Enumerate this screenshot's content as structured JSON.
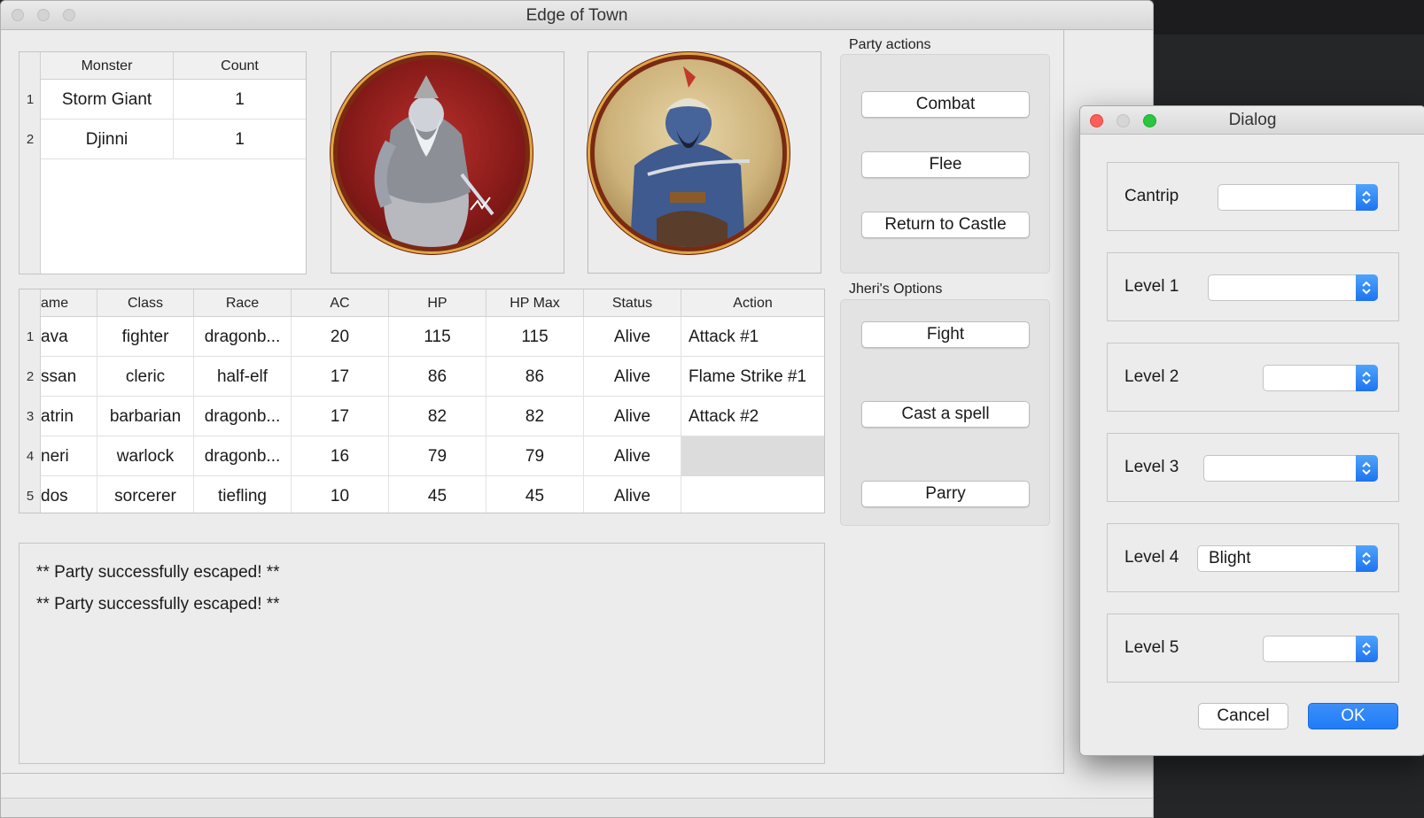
{
  "window": {
    "title": "Edge of Town"
  },
  "monster_table": {
    "headers": [
      "Monster",
      "Count"
    ],
    "row_numbers": [
      "1",
      "2"
    ],
    "rows": [
      {
        "monster": "Storm Giant",
        "count": "1"
      },
      {
        "monster": "Djinni",
        "count": "1"
      }
    ]
  },
  "portraits": {
    "left": "storm-giant-portrait",
    "right": "djinni-portrait"
  },
  "party_table": {
    "headers": [
      "ame",
      "Class",
      "Race",
      "AC",
      "HP",
      "HP Max",
      "Status",
      "Action"
    ],
    "row_numbers": [
      "1",
      "2",
      "3",
      "4",
      "5"
    ],
    "rows": [
      {
        "name": "ava",
        "class": "fighter",
        "race": "dragonb...",
        "ac": "20",
        "hp": "115",
        "hp_max": "115",
        "status": "Alive",
        "action": "Attack #1"
      },
      {
        "name": "ssan",
        "class": "cleric",
        "race": "half-elf",
        "ac": "17",
        "hp": "86",
        "hp_max": "86",
        "status": "Alive",
        "action": "Flame Strike #1"
      },
      {
        "name": "atrin",
        "class": "barbarian",
        "race": "dragonb...",
        "ac": "17",
        "hp": "82",
        "hp_max": "82",
        "status": "Alive",
        "action": "Attack #2"
      },
      {
        "name": "neri",
        "class": "warlock",
        "race": "dragonb...",
        "ac": "16",
        "hp": "79",
        "hp_max": "79",
        "status": "Alive",
        "action": ""
      },
      {
        "name": "dos",
        "class": "sorcerer",
        "race": "tiefling",
        "ac": "10",
        "hp": "45",
        "hp_max": "45",
        "status": "Alive",
        "action": ""
      }
    ]
  },
  "party_actions": {
    "label": "Party actions",
    "buttons": [
      "Combat",
      "Flee",
      "Return to Castle"
    ]
  },
  "member_options": {
    "label": "Jheri's Options",
    "buttons": [
      "Fight",
      "Cast a spell",
      "Parry"
    ]
  },
  "log": {
    "lines": [
      "** Party successfully escaped! **",
      "** Party successfully escaped! **"
    ]
  },
  "dialog": {
    "title": "Dialog",
    "rows": [
      {
        "label": "Cantrip",
        "value": ""
      },
      {
        "label": "Level 1",
        "value": ""
      },
      {
        "label": "Level 2",
        "value": ""
      },
      {
        "label": "Level 3",
        "value": ""
      },
      {
        "label": "Level 4",
        "value": "Blight"
      },
      {
        "label": "Level 5",
        "value": ""
      }
    ],
    "cancel_label": "Cancel",
    "ok_label": "OK"
  },
  "colors": {
    "ok_button": "#1f7cf6",
    "close_dot": "#fc5f57",
    "minimize_dot": "#d6d6d6",
    "zoom_dot": "#2ac73e",
    "selected_cell": "#dcdcdc"
  }
}
